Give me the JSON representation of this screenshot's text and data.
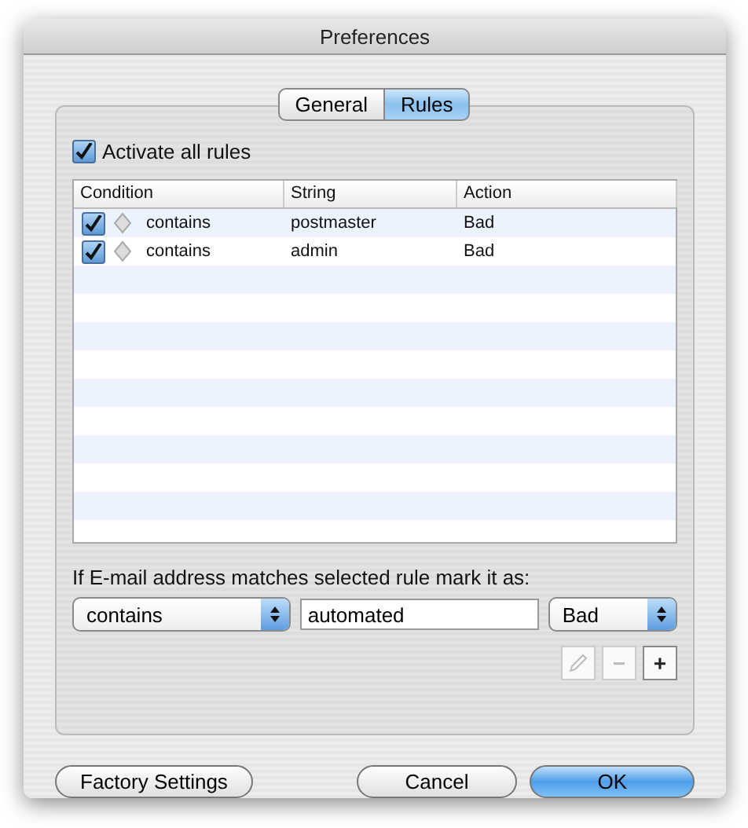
{
  "window": {
    "title": "Preferences"
  },
  "tabs": [
    {
      "label": "General",
      "selected": false
    },
    {
      "label": "Rules",
      "selected": true
    }
  ],
  "activate_all": {
    "label": "Activate all rules",
    "checked": true
  },
  "table": {
    "columns": [
      "Condition",
      "String",
      "Action"
    ],
    "rows": [
      {
        "checked": true,
        "condition": "contains",
        "string": "postmaster",
        "action": "Bad"
      },
      {
        "checked": true,
        "condition": "contains",
        "string": "admin",
        "action": "Bad"
      }
    ]
  },
  "rule_editor": {
    "label": "If E-mail address matches selected rule mark it as:",
    "condition": "contains",
    "value": "automated",
    "action": "Bad"
  },
  "rule_buttons": [
    {
      "kind": "edit",
      "disabled": true
    },
    {
      "kind": "remove",
      "text": "−",
      "disabled": true
    },
    {
      "kind": "add",
      "text": "+",
      "disabled": false
    }
  ],
  "buttons": [
    {
      "label": "Factory Settings",
      "default": false
    },
    {
      "label": "Cancel",
      "default": false
    },
    {
      "label": "OK",
      "default": true
    }
  ]
}
